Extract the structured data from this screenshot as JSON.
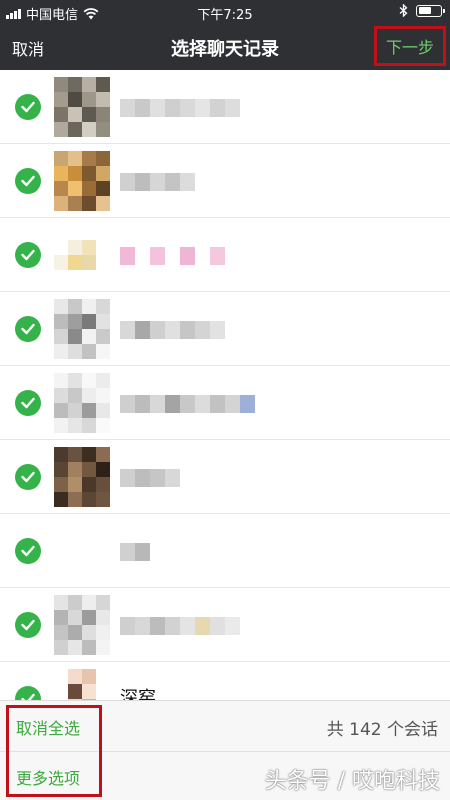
{
  "status_bar": {
    "carrier": "中国电信",
    "time": "下午7:25",
    "battery_level": 0.6
  },
  "nav": {
    "cancel_label": "取消",
    "title": "选择聊天记录",
    "next_label": "下一步"
  },
  "chats": [
    {
      "selected": true,
      "name": "",
      "avatar": [
        "#8f8a7c",
        "#6e6a5f",
        "#b7b0a2",
        "#5f5a50",
        "#a39c8d",
        "#4f4b43",
        "#9d978a",
        "#c2bcae",
        "#7a7568",
        "#c9c3b6",
        "#5e5a52",
        "#8b8578",
        "#b0aa9c",
        "#6b665c",
        "#d3cec2",
        "#948e81"
      ],
      "name_blocks": [
        "#d8d8d8",
        "#c9c9c9",
        "#e0e0e0",
        "#cfcfcf",
        "#d9d9d9",
        "#e5e5e5",
        "#d2d2d2",
        "#dddddd"
      ]
    },
    {
      "selected": true,
      "name": "",
      "avatar": [
        "#c9a574",
        "#e3c08a",
        "#a77a4a",
        "#8c6638",
        "#e8b45c",
        "#c98e3c",
        "#7d5a2e",
        "#d2a664",
        "#b9874c",
        "#f0c070",
        "#9a6c38",
        "#5c4326",
        "#dcb27a",
        "#a98050",
        "#6c4e2c",
        "#e6c290"
      ],
      "name_blocks": [
        "#d0d0d0",
        "#bdbdbd",
        "#d6d6d6",
        "#c4c4c4",
        "#dcdcdc"
      ]
    },
    {
      "selected": true,
      "name": "",
      "avatar": [
        "#ffffff",
        "#ffffff",
        "#ffffff",
        "#ffffff",
        "#ffffff",
        "#f5efe0",
        "#f2e2b8",
        "#ffffff",
        "#f7f1e6",
        "#f0d890",
        "#ead9a8",
        "#ffffff",
        "#ffffff",
        "#ffffff",
        "#ffffff",
        "#ffffff"
      ],
      "name_blocks": [
        "#f2b8d8",
        "#ffffff",
        "#f4c2dc",
        "#ffffff",
        "#f0b4d4",
        "#ffffff",
        "#f6c8e0"
      ]
    },
    {
      "selected": true,
      "name": "",
      "avatar": [
        "#e8e8e8",
        "#c8c8c8",
        "#f0f0f0",
        "#d8d8d8",
        "#bcbcbc",
        "#9e9e9e",
        "#7a7a7a",
        "#e2e2e2",
        "#d4d4d4",
        "#8a8a8a",
        "#f2f2f2",
        "#cacaca",
        "#eeeeee",
        "#dedede",
        "#c2c2c2",
        "#f6f6f6"
      ],
      "name_blocks": [
        "#d8d8d8",
        "#a8a8a8",
        "#cfcfcf",
        "#e0e0e0",
        "#c6c6c6",
        "#d4d4d4",
        "#e2e2e2"
      ]
    },
    {
      "selected": true,
      "name": "",
      "avatar": [
        "#f4f4f4",
        "#e2e2e2",
        "#f8f8f8",
        "#ececec",
        "#dcdcdc",
        "#c8c8c8",
        "#ededed",
        "#f6f6f6",
        "#bcbcbc",
        "#d2d2d2",
        "#9c9c9c",
        "#e8e8e8",
        "#f2f2f2",
        "#e6e6e6",
        "#d8d8d8",
        "#fafafa"
      ],
      "name_blocks": [
        "#cfcfcf",
        "#bcbcbc",
        "#d8d8d8",
        "#a4a4a4",
        "#c8c8c8",
        "#dcdcdc",
        "#c2c2c2",
        "#d4d4d4",
        "#9fb0d8"
      ]
    },
    {
      "selected": true,
      "name": "",
      "avatar": [
        "#4c3a2c",
        "#6a5240",
        "#3e2e22",
        "#8a6c52",
        "#5a4434",
        "#a0805e",
        "#72583e",
        "#2e2218",
        "#7e6248",
        "#b08e6a",
        "#4a382a",
        "#66503c",
        "#3a2c20",
        "#8e6e52",
        "#5c4634",
        "#6e5640"
      ],
      "name_blocks": [
        "#cfcfcf",
        "#bdbdbd",
        "#c6c6c6",
        "#d8d8d8"
      ]
    },
    {
      "selected": true,
      "name": "",
      "avatar": [
        "#ffffff",
        "#ffffff",
        "#ffffff",
        "#ffffff",
        "#ffffff",
        "#ffffff",
        "#ffffff",
        "#ffffff",
        "#ffffff",
        "#ffffff",
        "#ffffff",
        "#ffffff",
        "#ffffff",
        "#ffffff",
        "#ffffff",
        "#ffffff"
      ],
      "name_blocks": [
        "#d0d0d0",
        "#b8b8b8"
      ]
    },
    {
      "selected": true,
      "name": "",
      "avatar": [
        "#e4e4e4",
        "#cccccc",
        "#eeeeee",
        "#d6d6d6",
        "#b4b4b4",
        "#d8d8d8",
        "#9c9c9c",
        "#e8e8e8",
        "#c4c4c4",
        "#acacac",
        "#dedede",
        "#f0f0f0",
        "#d0d0d0",
        "#e6e6e6",
        "#bcbcbc",
        "#f4f4f4"
      ],
      "name_blocks": [
        "#cfcfcf",
        "#d8d8d8",
        "#bcbcbc",
        "#d2d2d2",
        "#e4e4e4",
        "#e8d8b0",
        "#e0e0e0",
        "#eaeaea"
      ]
    },
    {
      "selected": true,
      "name": "深窑",
      "avatar": [
        "#ffffff",
        "#f3dccb",
        "#e8c4ae",
        "#ffffff",
        "#ffffff",
        "#6b4a3a",
        "#f6e2d2",
        "#ffffff",
        "#ffffff",
        "#f2d8c4",
        "#e9a0a0",
        "#ffffff",
        "#ffffff",
        "#ffffff",
        "#ffffff",
        "#ffffff"
      ],
      "name_blocks": []
    }
  ],
  "bottom": {
    "deselect_all_label": "取消全选",
    "more_options_label": "更多选项",
    "count_label": "共 142 个会话",
    "watermark": "头条号 / 哎咆科技"
  },
  "colors": {
    "bar_bg": "#2e3034",
    "accent_green": "#6fd16b",
    "check_green": "#35b34a",
    "highlight_red": "#c0111a"
  },
  "icons": [
    "signal-icon",
    "wifi-icon",
    "bluetooth-icon",
    "battery-icon",
    "check-icon"
  ]
}
